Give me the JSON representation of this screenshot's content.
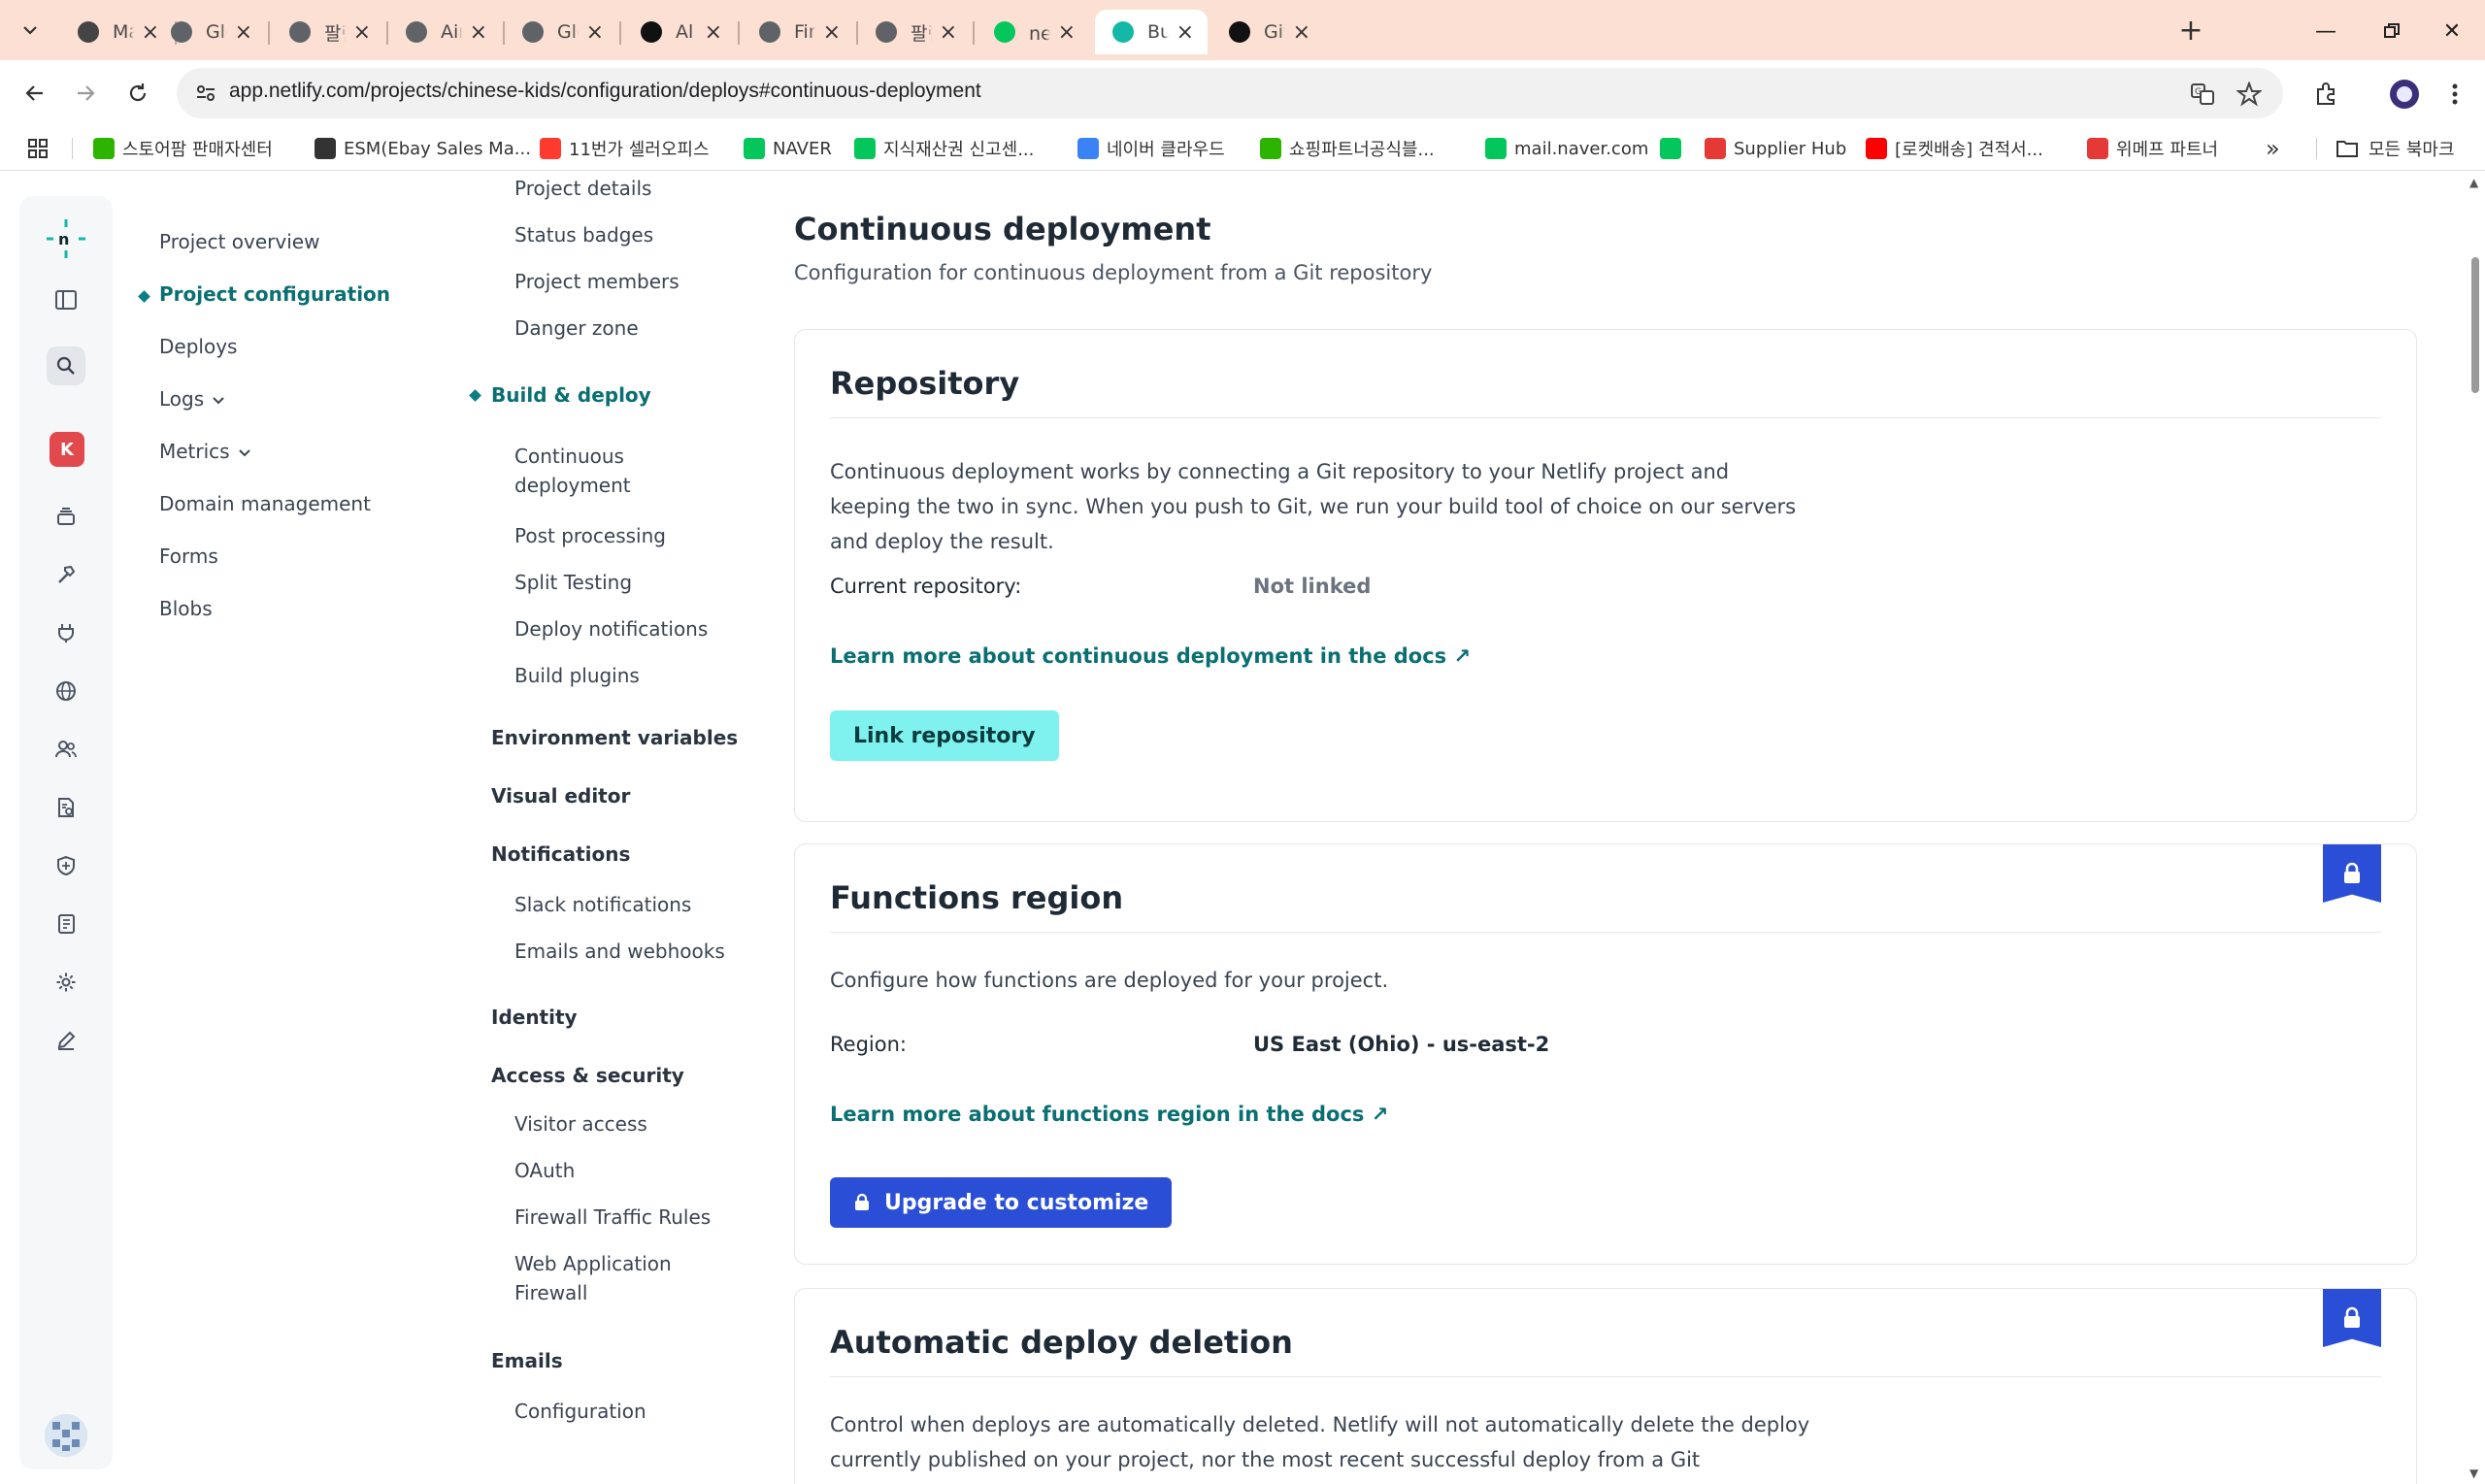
{
  "browser": {
    "tabs": [
      {
        "title": "Manus",
        "favicon_color": "#444444",
        "active": false
      },
      {
        "title": "Global Tem",
        "favicon_color": "#5f6368",
        "active": false
      },
      {
        "title": "팔란티어 즉",
        "favicon_color": "#5f6368",
        "active": false
      },
      {
        "title": "Airo Group",
        "favicon_color": "#5f6368",
        "active": false
      },
      {
        "title": "Global Dial",
        "favicon_color": "#5f6368",
        "active": false
      },
      {
        "title": "Al Jaddaf D",
        "favicon_color": "#111111",
        "active": false
      },
      {
        "title": "Finance Da",
        "favicon_color": "#5f6368",
        "active": false
      },
      {
        "title": "팔란티어 즉",
        "favicon_color": "#5f6368",
        "active": false
      },
      {
        "title": "netlify : 네",
        "favicon_color": "#03c75a",
        "active": false
      },
      {
        "title": "Build & de",
        "favicon_color": "#14b8a6",
        "active": true
      },
      {
        "title": "GitHub Da",
        "favicon_color": "#111111",
        "active": false
      }
    ],
    "url": "app.netlify.com/projects/chinese-kids/configuration/deploys#continuous-deployment",
    "bookmarks": [
      {
        "label": "스토어팜 판매자센터",
        "color": "#2db400"
      },
      {
        "label": "ESM(Ebay Sales Ma...",
        "color": "#333333"
      },
      {
        "label": "11번가 셀러오피스",
        "color": "#ff3b30"
      },
      {
        "label": "NAVER",
        "color": "#03c75a"
      },
      {
        "label": "지식재산권 신고센...",
        "color": "#03c75a"
      },
      {
        "label": "네이버 클라우드",
        "color": "#3b82f6"
      },
      {
        "label": "쇼핑파트너공식블...",
        "color": "#2db400"
      },
      {
        "label": "mail.naver.com",
        "color": "#03c75a"
      },
      {
        "label": "",
        "color": "#03c75a"
      },
      {
        "label": "Supplier Hub",
        "color": "#e53935"
      },
      {
        "label": "[로켓배송] 견적서...",
        "color": "#ff0000"
      },
      {
        "label": "위메프 파트너",
        "color": "#e53935"
      }
    ],
    "all_bookmarks_label": "모든 북마크",
    "more_label": "»"
  },
  "rail": {
    "workspace_initial": "K"
  },
  "primary_nav": [
    {
      "label": "Project overview",
      "active": false
    },
    {
      "label": "Project configuration",
      "active": true
    },
    {
      "label": "Deploys",
      "active": false
    },
    {
      "label": "Logs",
      "active": false,
      "chevron": true
    },
    {
      "label": "Metrics",
      "active": false,
      "chevron": true
    },
    {
      "label": "Domain management",
      "active": false
    },
    {
      "label": "Forms",
      "active": false
    },
    {
      "label": "Blobs",
      "active": false
    }
  ],
  "config_nav": {
    "general_items": [
      "Project details",
      "Status badges",
      "Project members",
      "Danger zone"
    ],
    "build_deploy": {
      "label": "Build & deploy",
      "items": [
        "Continuous deployment",
        "Post processing",
        "Split Testing",
        "Deploy notifications",
        "Build plugins"
      ]
    },
    "env_vars": "Environment variables",
    "visual_editor": "Visual editor",
    "notifications": {
      "label": "Notifications",
      "items": [
        "Slack notifications",
        "Emails and webhooks"
      ]
    },
    "identity": "Identity",
    "access_security": {
      "label": "Access & security",
      "items": [
        "Visitor access",
        "OAuth",
        "Firewall Traffic Rules",
        "Web Application Firewall"
      ]
    },
    "emails": {
      "label": "Emails",
      "items": [
        "Configuration"
      ]
    }
  },
  "content": {
    "title": "Continuous deployment",
    "subtitle": "Configuration for continuous deployment from a Git repository",
    "repository": {
      "title": "Repository",
      "description": "Continuous deployment works by connecting a Git repository to your Netlify project and keeping the two in sync. When you push to Git, we run your build tool of choice on our servers and deploy the result.",
      "current_label": "Current repository:",
      "current_value": "Not linked",
      "docs_link": "Learn more about continuous deployment in the docs ↗",
      "button": "Link repository"
    },
    "functions_region": {
      "title": "Functions region",
      "description": "Configure how functions are deployed for your project.",
      "region_label": "Region:",
      "region_value": "US East (Ohio) - us-east-2",
      "docs_link": "Learn more about functions region in the docs ↗",
      "button": "Upgrade to customize"
    },
    "auto_deletion": {
      "title": "Automatic deploy deletion",
      "description": "Control when deploys are automatically deleted. Netlify will not automatically delete the deploy currently published on your project, nor the most recent successful deploy from a Git"
    }
  },
  "colors": {
    "accent_teal": "#0a6f72",
    "link_button": "#7ff2ef",
    "upgrade_button": "#2a4fd6",
    "tab_strip": "#fbe0d3"
  }
}
